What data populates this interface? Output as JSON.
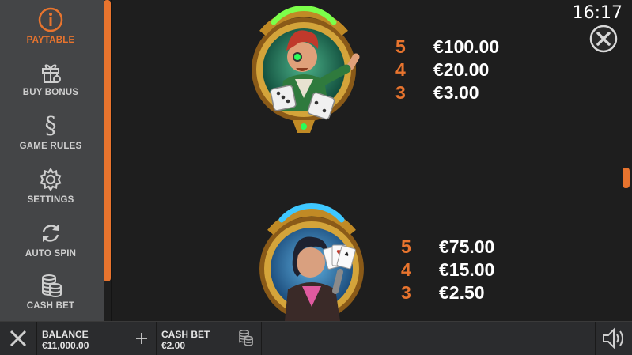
{
  "sidebar": {
    "items": [
      {
        "label": "PAYTABLE",
        "icon": "info-icon",
        "active": true
      },
      {
        "label": "BUY BONUS",
        "icon": "gift-icon",
        "active": false
      },
      {
        "label": "GAME RULES",
        "icon": "section-icon",
        "active": false
      },
      {
        "label": "SETTINGS",
        "icon": "gear-icon",
        "active": false
      },
      {
        "label": "AUTO SPIN",
        "icon": "autospin-icon",
        "active": false
      },
      {
        "label": "CASH BET",
        "icon": "coins-icon",
        "active": false
      }
    ]
  },
  "clock": "16:17",
  "paytable": [
    {
      "symbol": "red-haired-dice-gambler",
      "rows": [
        {
          "count": "5",
          "value": "€100.00"
        },
        {
          "count": "4",
          "value": "€20.00"
        },
        {
          "count": "3",
          "value": "€3.00"
        }
      ]
    },
    {
      "symbol": "card-player",
      "rows": [
        {
          "count": "5",
          "value": "€75.00"
        },
        {
          "count": "4",
          "value": "€15.00"
        },
        {
          "count": "3",
          "value": "€2.50"
        }
      ]
    }
  ],
  "bottom_bar": {
    "balance_label": "BALANCE",
    "balance_value": "€11,000.00",
    "cash_bet_label": "CASH BET",
    "cash_bet_value": "€2.00"
  },
  "colors": {
    "accent": "#e8742e",
    "sidebar": "#444547",
    "background": "#1e1e1e"
  }
}
